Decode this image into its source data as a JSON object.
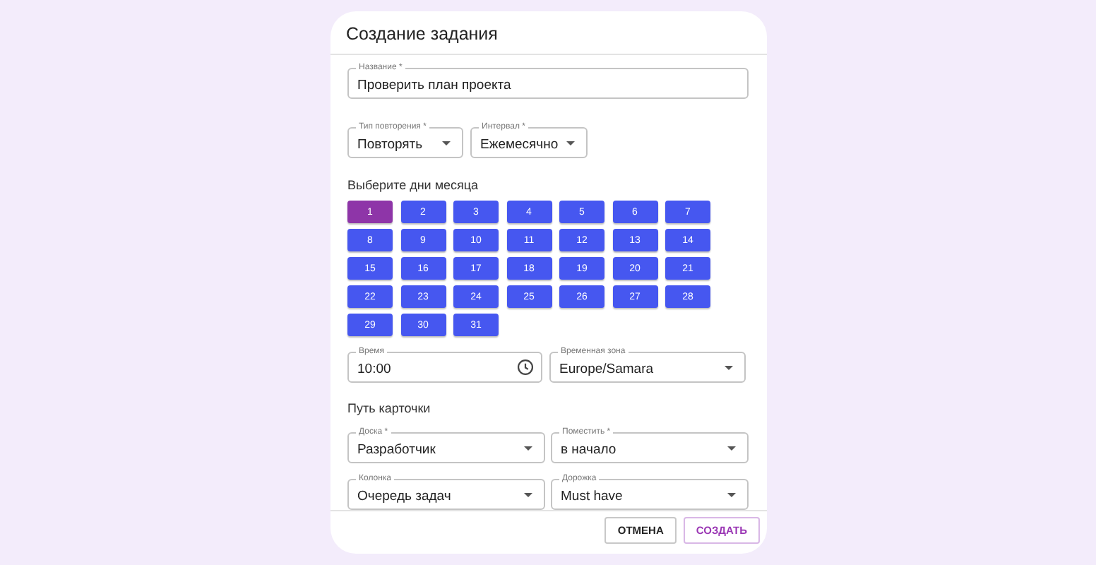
{
  "dialog": {
    "title": "Создание задания"
  },
  "name_field": {
    "label": "Название *",
    "value": "Проверить план проекта"
  },
  "repeat_fields": [
    {
      "kind": "select",
      "label": "Тип повторения *",
      "value": "Повторять"
    },
    {
      "kind": "select",
      "label": "Интервал *",
      "value": "Ежемесячно"
    }
  ],
  "days": {
    "label": "Выберите дни месяца",
    "items": [
      {
        "label": "1",
        "selected": true
      },
      {
        "label": "2",
        "selected": false
      },
      {
        "label": "3",
        "selected": false
      },
      {
        "label": "4",
        "selected": false
      },
      {
        "label": "5",
        "selected": false
      },
      {
        "label": "6",
        "selected": false
      },
      {
        "label": "7",
        "selected": false
      },
      {
        "label": "8",
        "selected": false
      },
      {
        "label": "9",
        "selected": false
      },
      {
        "label": "10",
        "selected": false
      },
      {
        "label": "11",
        "selected": false
      },
      {
        "label": "12",
        "selected": false
      },
      {
        "label": "13",
        "selected": false
      },
      {
        "label": "14",
        "selected": false
      },
      {
        "label": "15",
        "selected": false
      },
      {
        "label": "16",
        "selected": false
      },
      {
        "label": "17",
        "selected": false
      },
      {
        "label": "18",
        "selected": false
      },
      {
        "label": "19",
        "selected": false
      },
      {
        "label": "20",
        "selected": false
      },
      {
        "label": "21",
        "selected": false
      },
      {
        "label": "22",
        "selected": false
      },
      {
        "label": "23",
        "selected": false
      },
      {
        "label": "24",
        "selected": false
      },
      {
        "label": "25",
        "selected": false
      },
      {
        "label": "26",
        "selected": false
      },
      {
        "label": "27",
        "selected": false
      },
      {
        "label": "28",
        "selected": false
      },
      {
        "label": "29",
        "selected": false
      },
      {
        "label": "30",
        "selected": false
      },
      {
        "label": "31",
        "selected": false
      }
    ]
  },
  "time_fields": [
    {
      "kind": "time",
      "label": "Время",
      "value": "10:00"
    },
    {
      "kind": "select",
      "label": "Временная зона",
      "value": "Europe/Samara"
    }
  ],
  "card_path": {
    "label": "Путь карточки",
    "fields": [
      {
        "kind": "select",
        "label": "Доска *",
        "value": "Разработчик"
      },
      {
        "kind": "select",
        "label": "Поместить *",
        "value": "в начало"
      },
      {
        "kind": "select",
        "label": "Колонка",
        "value": "Очередь задач"
      },
      {
        "kind": "select",
        "label": "Дорожка",
        "value": "Must have"
      }
    ]
  },
  "buttons": [
    {
      "kind": "secondary",
      "label": "ОТМЕНА"
    },
    {
      "kind": "primary",
      "label": "СОЗДАТЬ"
    }
  ]
}
